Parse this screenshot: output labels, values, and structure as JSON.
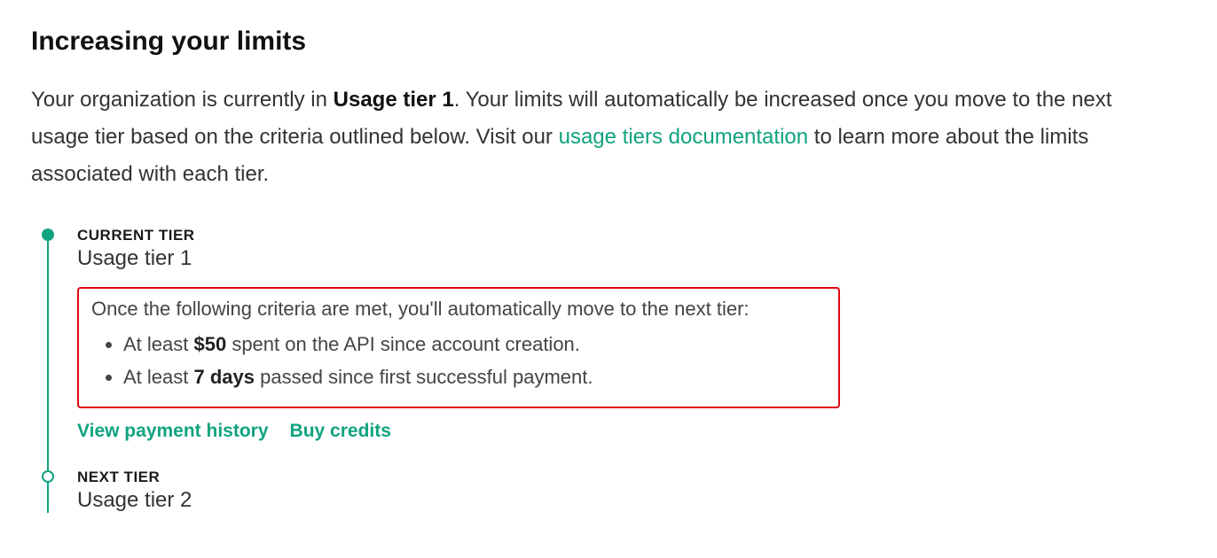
{
  "heading": "Increasing your limits",
  "intro": {
    "part1": "Your organization is currently in ",
    "bold_tier": "Usage tier 1",
    "part2": ". Your limits will automatically be increased once you move to the next usage tier based on the criteria outlined below. Visit our ",
    "link_text": "usage tiers documentation",
    "part3": " to learn more about the limits associated with each tier."
  },
  "current_tier": {
    "label": "CURRENT TIER",
    "name": "Usage tier 1"
  },
  "criteria": {
    "intro": "Once the following criteria are met, you'll automatically move to the next tier:",
    "item1_pre": "At least ",
    "item1_bold": "$50",
    "item1_post": " spent on the API since account creation.",
    "item2_pre": "At least ",
    "item2_bold": "7 days",
    "item2_post": " passed since first successful payment."
  },
  "actions": {
    "view_payment_history": "View payment history",
    "buy_credits": "Buy credits"
  },
  "next_tier": {
    "label": "NEXT TIER",
    "name": "Usage tier 2"
  }
}
